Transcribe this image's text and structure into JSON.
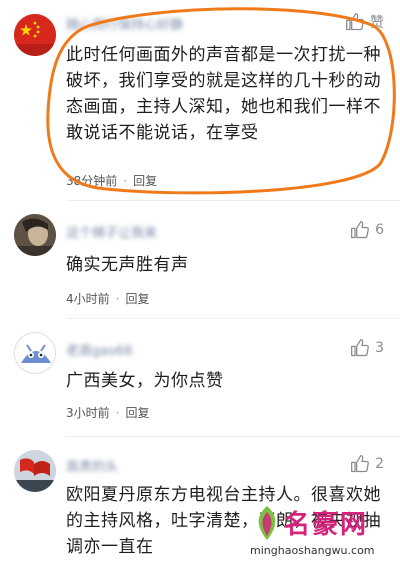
{
  "comments": [
    {
      "username": "随心而行保持心好静",
      "likes": "赞",
      "text": "此时任何画面外的声音都是一次打扰一种破坏，我们享受的就是这样的几十秒的动态画面，主持人深知，她也和我们一样不敢说话不能说话，在享受",
      "time": "38分钟前",
      "reply": "回复"
    },
    {
      "username": "这个梯子让我来",
      "likes": "6",
      "text": "确实无声胜有声",
      "time": "4小时前",
      "reply": "回复"
    },
    {
      "username": "老高gao66",
      "likes": "3",
      "text": "广西美女，为你点赞",
      "time": "3小时前",
      "reply": "回复"
    },
    {
      "username": "高贵的头",
      "likes": "2",
      "text": "欧阳夏丹原东方电视台主持人。很喜欢她的主持风格，吐字清楚，开朗，被央视抽调亦一直在",
      "time": "",
      "reply": ""
    }
  ],
  "watermark": {
    "title": "名豪网",
    "url": "minghaoshangwu.com"
  },
  "colors": {
    "ellipse": "#f07a1a",
    "username": "#7d8aa8",
    "watermark": "#d4237a"
  }
}
